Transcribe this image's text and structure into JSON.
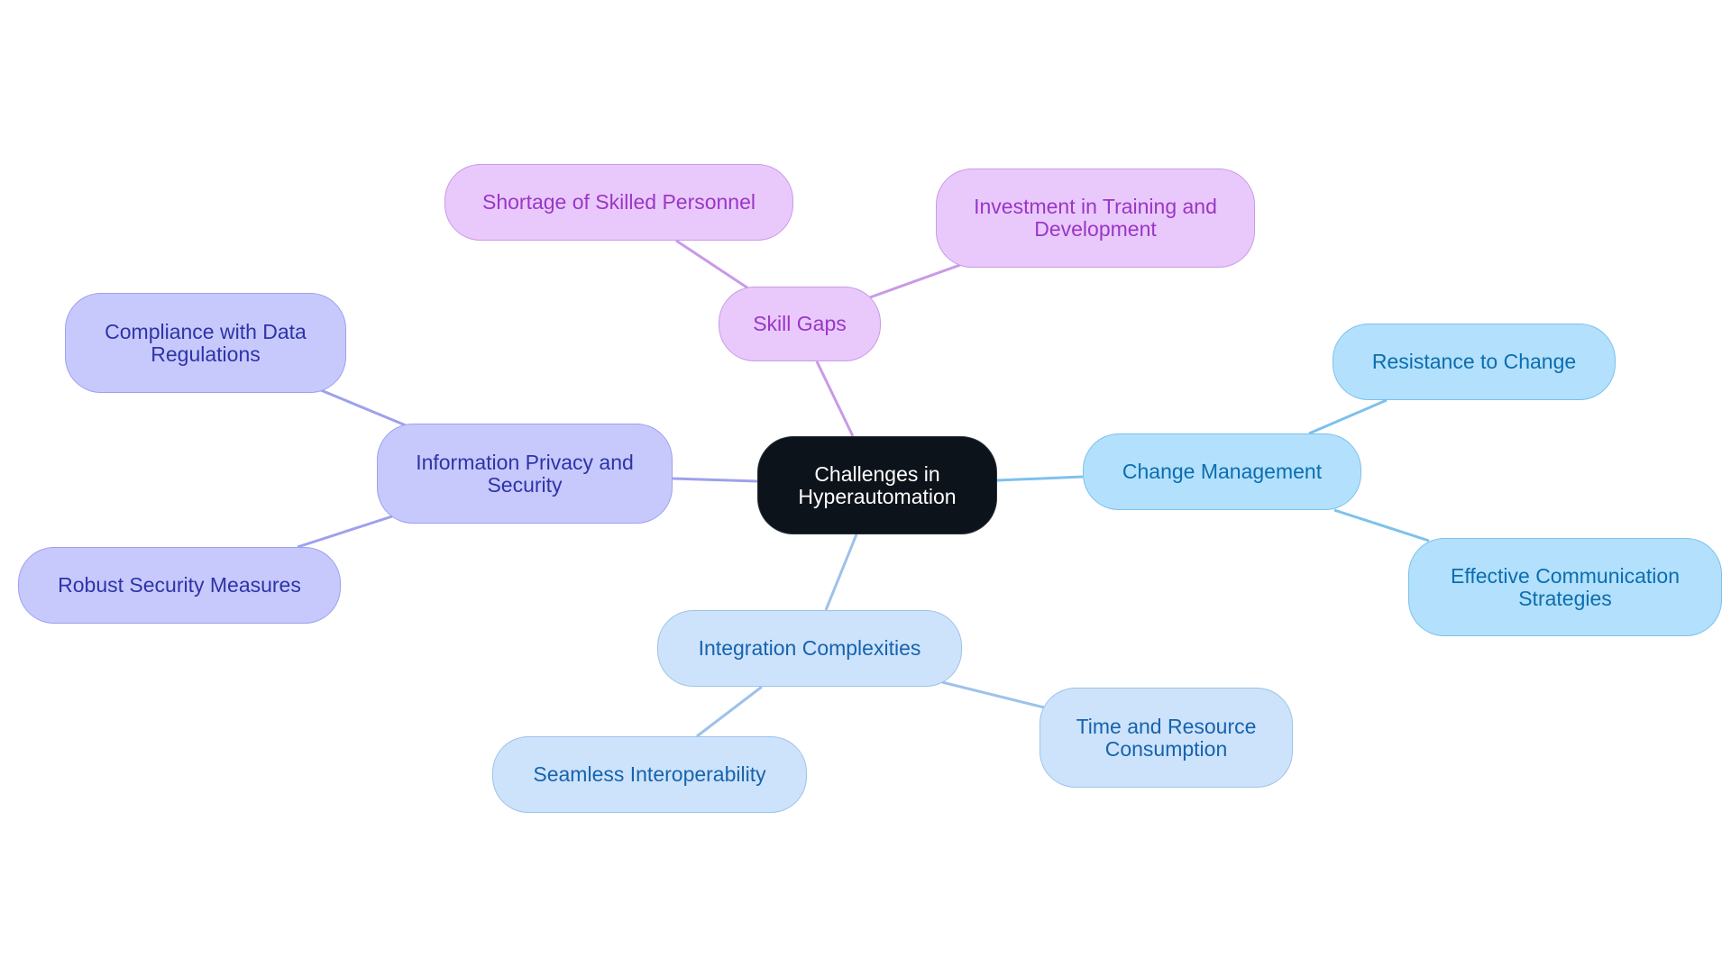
{
  "root": {
    "label": "Challenges in Hyperautomation"
  },
  "branches": {
    "skill_gaps": {
      "label": "Skill Gaps",
      "color": "#c99ae6",
      "children": [
        "Shortage of Skilled Personnel",
        "Investment in Training and Development"
      ]
    },
    "privacy": {
      "label": "Information Privacy and Security",
      "color": "#9da1ec",
      "children": [
        "Compliance with Data Regulations",
        "Robust Security Measures"
      ]
    },
    "change": {
      "label": "Change Management",
      "color": "#7dc1ec",
      "children": [
        "Resistance to Change",
        "Effective Communication Strategies"
      ]
    },
    "integration": {
      "label": "Integration Complexities",
      "color": "#9dc2ea",
      "children": [
        "Seamless Interoperability",
        "Time and Resource Consumption"
      ]
    }
  }
}
